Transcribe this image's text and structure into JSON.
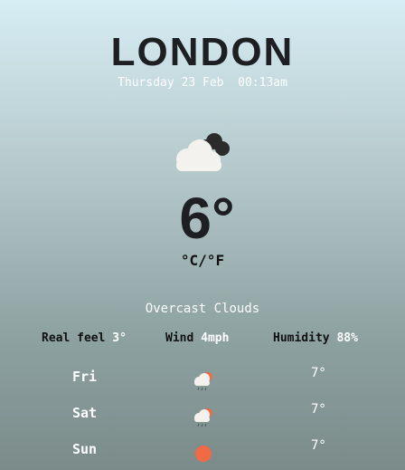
{
  "header": {
    "city": "LONDON",
    "datetime": "Thursday 23 Feb  00:13am"
  },
  "current": {
    "icon": "overcast-clouds-icon",
    "temperature": "6°",
    "unit_toggle": "°C/°F",
    "description": "Overcast Clouds"
  },
  "stats": {
    "real_feel_label": "Real feel",
    "real_feel_value": "3°",
    "wind_label": "Wind",
    "wind_value": "4mph",
    "humidity_label": "Humidity",
    "humidity_value": "88%"
  },
  "forecast": [
    {
      "day": "Fri",
      "icon": "rain-cloud-sun-icon",
      "temp": "7°"
    },
    {
      "day": "Sat",
      "icon": "rain-cloud-sun-icon",
      "temp": "7°"
    },
    {
      "day": "Sun",
      "icon": "sun-icon",
      "temp": "7°"
    }
  ],
  "colors": {
    "sun": "#f06a45",
    "text_dark": "#1e1f22",
    "text_light": "#ffffff"
  }
}
